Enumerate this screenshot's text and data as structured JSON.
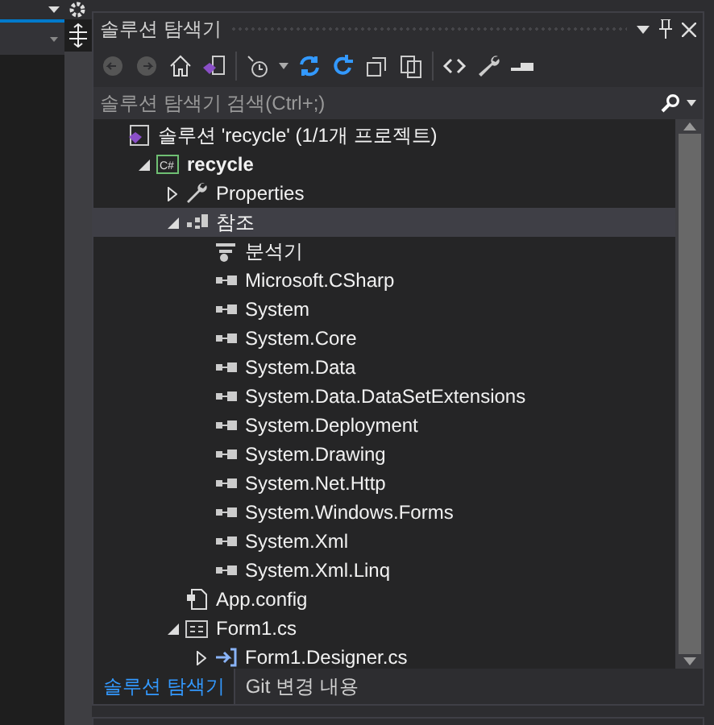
{
  "panel": {
    "title": "솔루션 탐색기"
  },
  "search": {
    "placeholder": "솔루션 탐색기 검색(Ctrl+;)"
  },
  "tree": [
    {
      "label": "솔루션 'recycle' (1/1개 프로젝트)",
      "kind": "solution",
      "selected": false,
      "children": [
        {
          "label": "recycle",
          "kind": "project",
          "icon_text": "C#",
          "bold": true,
          "expanded": true,
          "selected": false,
          "children": [
            {
              "label": "Properties",
              "kind": "properties",
              "expanded": false,
              "selected": false
            },
            {
              "label": "참조",
              "kind": "references",
              "expanded": true,
              "selected": true,
              "children": [
                {
                  "label": "분석기",
                  "kind": "analyzer",
                  "selected": false
                },
                {
                  "label": "Microsoft.CSharp",
                  "kind": "assembly",
                  "selected": false
                },
                {
                  "label": "System",
                  "kind": "assembly",
                  "selected": false
                },
                {
                  "label": "System.Core",
                  "kind": "assembly",
                  "selected": false
                },
                {
                  "label": "System.Data",
                  "kind": "assembly",
                  "selected": false
                },
                {
                  "label": "System.Data.DataSetExtensions",
                  "kind": "assembly",
                  "selected": false
                },
                {
                  "label": "System.Deployment",
                  "kind": "assembly",
                  "selected": false
                },
                {
                  "label": "System.Drawing",
                  "kind": "assembly",
                  "selected": false
                },
                {
                  "label": "System.Net.Http",
                  "kind": "assembly",
                  "selected": false
                },
                {
                  "label": "System.Windows.Forms",
                  "kind": "assembly",
                  "selected": false
                },
                {
                  "label": "System.Xml",
                  "kind": "assembly",
                  "selected": false
                },
                {
                  "label": "System.Xml.Linq",
                  "kind": "assembly",
                  "selected": false
                }
              ]
            },
            {
              "label": "App.config",
              "kind": "config",
              "selected": false
            },
            {
              "label": "Form1.cs",
              "kind": "form",
              "expanded": true,
              "selected": false,
              "children": [
                {
                  "label": "Form1.Designer.cs",
                  "kind": "designer",
                  "expanded": false,
                  "selected": false
                }
              ]
            }
          ]
        }
      ]
    }
  ],
  "tabs": [
    {
      "label": "솔루션 탐색기",
      "selected": true
    },
    {
      "label": "Git 변경 내용",
      "selected": false
    }
  ]
}
